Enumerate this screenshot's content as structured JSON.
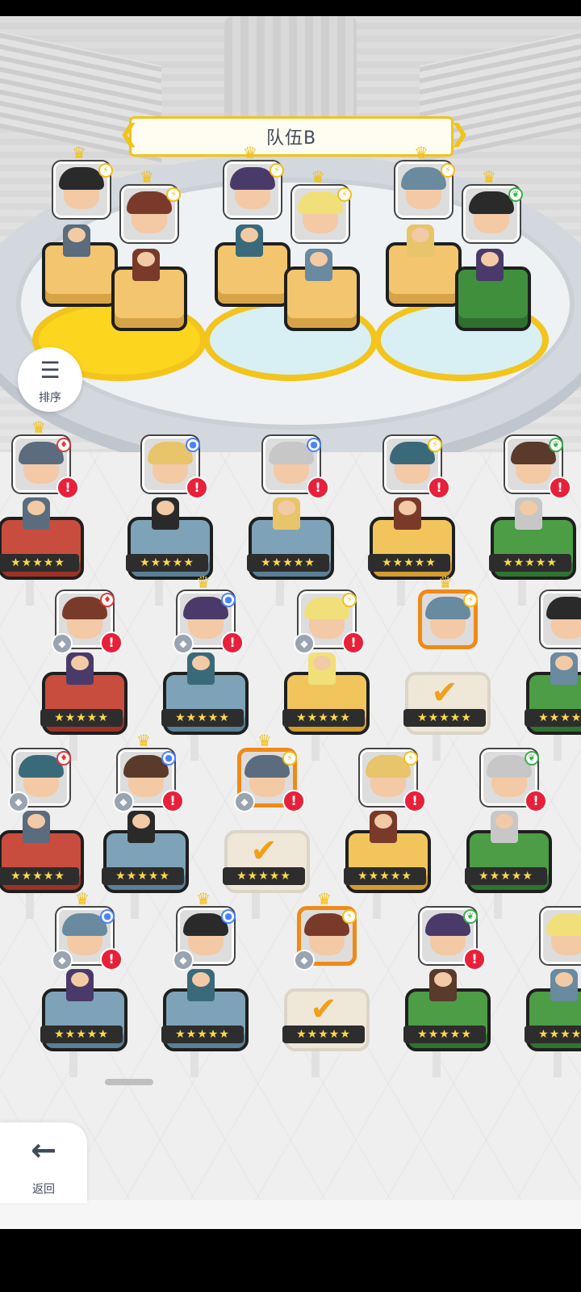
{
  "team": {
    "title": "队伍B"
  },
  "controls": {
    "sort_label": "排序",
    "back_label": "返回",
    "sort_icon": "sort-icon",
    "back_icon": "arrow-left-icon"
  },
  "colors": {
    "accent_yellow": "#f3c51c",
    "alert_red": "#e8203a",
    "selected_orange": "#f08a17",
    "text_dark": "#3f4a5a"
  },
  "stars_text": "★★★★★",
  "arena_slots": [
    {
      "element": "lightning",
      "crown": true,
      "pedestal": "sand"
    },
    {
      "element": "lightning",
      "crown": true,
      "pedestal": "sand"
    },
    {
      "element": "lightning",
      "crown": true,
      "pedestal": "sand"
    },
    {
      "element": "lightning",
      "crown": true,
      "pedestal": "sand"
    },
    {
      "element": "lightning",
      "crown": true,
      "pedestal": "sand"
    },
    {
      "element": "leaf",
      "crown": true,
      "pedestal": "grass"
    }
  ],
  "roster_rows": [
    {
      "units": [
        {
          "element": "fire",
          "crown": true,
          "alert": true,
          "pedestal": "red"
        },
        {
          "element": "water",
          "crown": false,
          "alert": true,
          "pedestal": "blue"
        },
        {
          "element": "water",
          "crown": false,
          "alert": true,
          "pedestal": "blue"
        },
        {
          "element": "lightning",
          "crown": false,
          "alert": true,
          "pedestal": "gold"
        },
        {
          "element": "leaf",
          "crown": false,
          "alert": true,
          "pedestal": "green"
        }
      ]
    },
    {
      "units": [
        {
          "element": "fire",
          "crown": false,
          "alert": true,
          "pedestal": "red"
        },
        {
          "element": "water",
          "crown": true,
          "alert": true,
          "pedestal": "blue"
        },
        {
          "element": "lightning",
          "crown": false,
          "alert": true,
          "pedestal": "gold"
        },
        {
          "element": "lightning",
          "crown": true,
          "alert": false,
          "pedestal": "faded",
          "selected": true
        },
        {
          "element": "leaf",
          "crown": false,
          "alert": false,
          "pedestal": "green"
        }
      ]
    },
    {
      "units": [
        {
          "element": "fire",
          "crown": false,
          "alert": false,
          "pedestal": "red"
        },
        {
          "element": "water",
          "crown": true,
          "alert": true,
          "pedestal": "blue"
        },
        {
          "element": "lightning",
          "crown": true,
          "alert": true,
          "pedestal": "faded",
          "selected": true
        },
        {
          "element": "lightning",
          "crown": false,
          "alert": true,
          "pedestal": "gold"
        },
        {
          "element": "leaf",
          "crown": false,
          "alert": true,
          "pedestal": "green"
        }
      ]
    },
    {
      "units": [
        {
          "element": "water",
          "crown": true,
          "alert": true,
          "pedestal": "blue"
        },
        {
          "element": "water",
          "crown": true,
          "alert": false,
          "pedestal": "blue"
        },
        {
          "element": "lightning",
          "crown": true,
          "alert": false,
          "pedestal": "faded",
          "selected": true
        },
        {
          "element": "leaf",
          "crown": false,
          "alert": true,
          "pedestal": "green"
        },
        {
          "element": "leaf",
          "crown": false,
          "alert": false,
          "pedestal": "green"
        }
      ]
    }
  ]
}
